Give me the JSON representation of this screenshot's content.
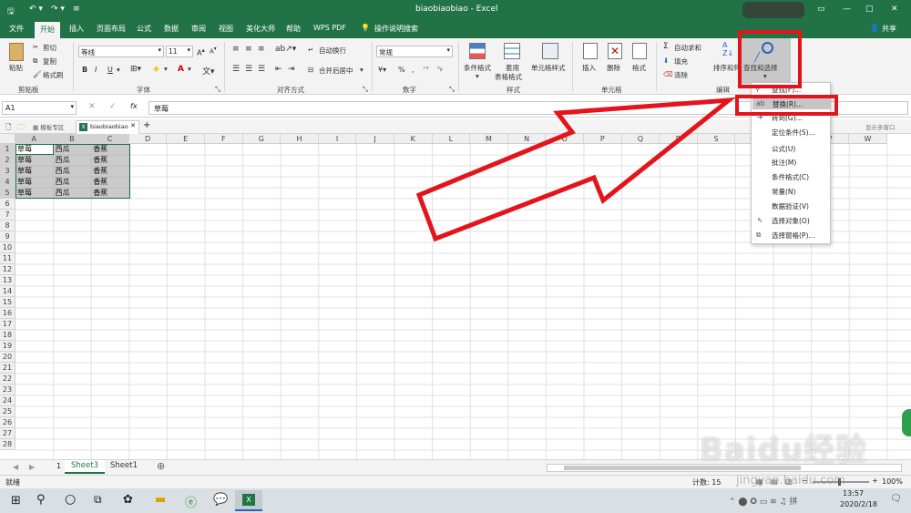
{
  "titlebar": {
    "title": "biaobiaobiao  -  Excel"
  },
  "tabs": [
    "文件",
    "开始",
    "插入",
    "页面布局",
    "公式",
    "数据",
    "审阅",
    "视图",
    "美化大师",
    "帮助",
    "WPS PDF"
  ],
  "tell_me": "操作说明搜索",
  "share": "共享",
  "ribbon": {
    "clipboard": {
      "paste": "粘贴",
      "cut": "剪切",
      "copy": "复制",
      "painter": "格式刷",
      "label": "剪贴板"
    },
    "font": {
      "name": "等线",
      "size": "11",
      "label": "字体",
      "bold": "B",
      "italic": "I",
      "underline": "U",
      "grow": "A",
      "shrink": "A"
    },
    "align": {
      "wrap": "自动换行",
      "merge": "合并后居中",
      "label": "对齐方式"
    },
    "number": {
      "format": "常规",
      "label": "数字"
    },
    "styles": {
      "cond": "条件格式",
      "table": "套用",
      "table2": "表格格式",
      "cell": "单元格样式",
      "label": "样式"
    },
    "cells": {
      "insert": "插入",
      "delete": "删除",
      "format": "格式",
      "label": "单元格"
    },
    "edit": {
      "autosum": "自动求和",
      "fill": "填充",
      "clear": "清除",
      "sort": "排序和筛选",
      "find": "查找和选择",
      "label": "编辑"
    }
  },
  "formula": {
    "namebox": "A1",
    "fx": "fx",
    "value": "草莓"
  },
  "doc_tabs": {
    "template": "模板专区",
    "file": "biaobiaobiao",
    "multi": "显示多窗口"
  },
  "columns": [
    "A",
    "B",
    "C",
    "D",
    "E",
    "F",
    "G",
    "H",
    "I",
    "J",
    "K",
    "L",
    "M",
    "N",
    "O",
    "P",
    "Q",
    "R",
    "S",
    "T",
    "U",
    "V",
    "W"
  ],
  "rows": [
    "1",
    "2",
    "3",
    "4",
    "5",
    "6",
    "7",
    "8",
    "9",
    "10",
    "11",
    "12",
    "13",
    "14",
    "15",
    "16",
    "17",
    "18",
    "19",
    "20",
    "21",
    "22",
    "23",
    "24",
    "25",
    "26",
    "27",
    "28"
  ],
  "cells": [
    [
      "草莓",
      "西瓜",
      "香蕉"
    ],
    [
      "草莓",
      "西瓜",
      "香蕉"
    ],
    [
      "草莓",
      "西瓜",
      "香蕉"
    ],
    [
      "草莓",
      "西瓜",
      "香蕉"
    ],
    [
      "草莓",
      "西瓜",
      "香蕉"
    ]
  ],
  "sheets": [
    "1",
    "Sheet3",
    "Sheet1"
  ],
  "status": {
    "ready": "就绪",
    "count": "计数: 15",
    "zoom": "100%"
  },
  "menu": [
    "查找(F)...",
    "替换(R)...",
    "转到(G)...",
    "定位条件(S)...",
    "公式(U)",
    "批注(M)",
    "条件格式(C)",
    "常量(N)",
    "数据验证(V)",
    "选择对象(O)",
    "选择窗格(P)..."
  ],
  "clock": {
    "time": "13:57",
    "date": "2020/2/18"
  },
  "watermark": "Baidu经验",
  "watermark_url": "jingyan.baidu.com",
  "colors": {
    "excel_green": "#217346",
    "highlight_red": "#e3141b",
    "selection": "#c6c6c6"
  }
}
